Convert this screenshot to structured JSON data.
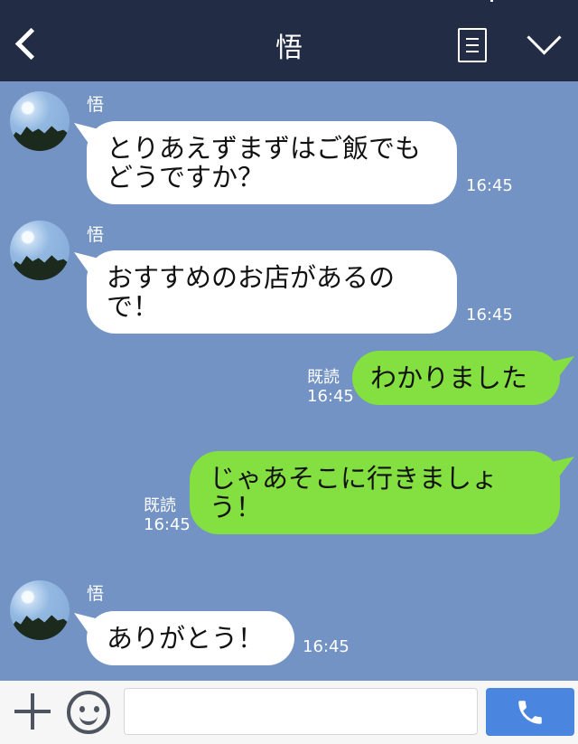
{
  "header": {
    "title": "悟"
  },
  "messages": [
    {
      "sender": "悟",
      "text": "とりあえずまずはご飯でもどうですか？",
      "time": "16:45"
    },
    {
      "sender": "悟",
      "text": "おすすめのお店があるので！",
      "time": "16:45"
    },
    {
      "read": "既読",
      "text": "わかりました",
      "time": "16:45"
    },
    {
      "read": "既読",
      "text": "じゃあそこに行きましょう！",
      "time": "16:45"
    },
    {
      "sender": "悟",
      "text": "ありがとう！",
      "time": "16:45"
    }
  ],
  "composer": {
    "placeholder": ""
  },
  "colors": {
    "header_bg": "#232c45",
    "chat_bg": "#7393c4",
    "outgoing_bubble": "#83e040",
    "incoming_bubble": "#ffffff",
    "call_button": "#4a86e0"
  },
  "icons": {
    "back": "chevron-left-icon",
    "menu": "list-icon",
    "collapse": "chevron-down-icon",
    "add": "plus-icon",
    "emoji": "smiley-icon",
    "call": "phone-icon"
  }
}
